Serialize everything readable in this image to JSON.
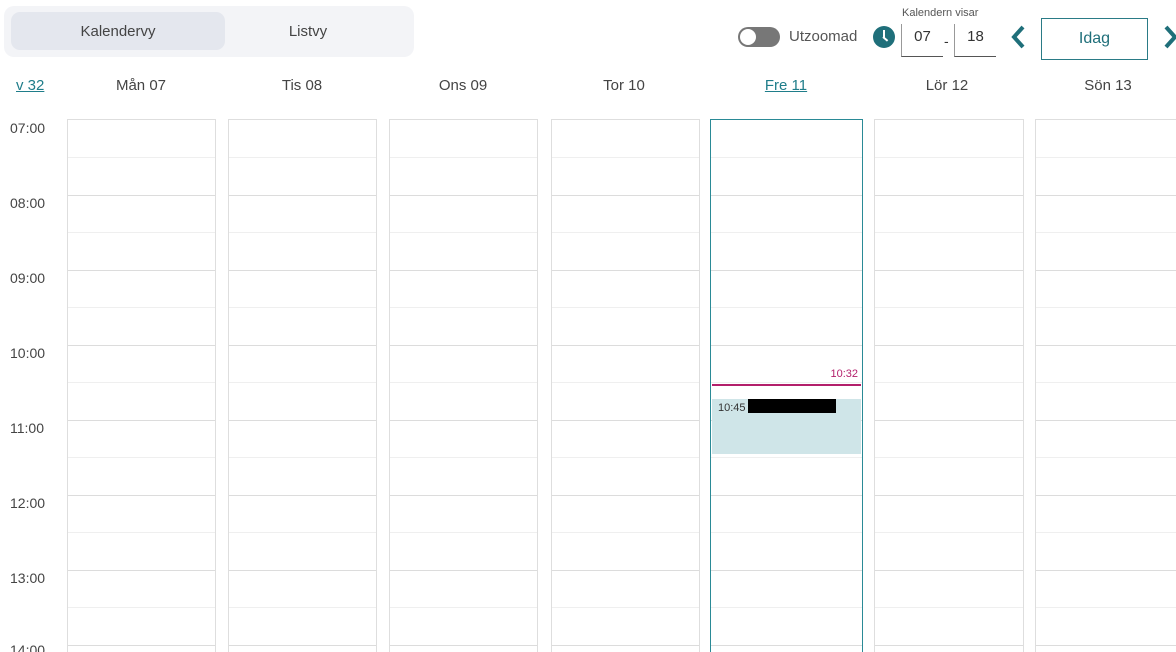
{
  "views": {
    "calendar_label": "Kalendervy",
    "list_label": "Listvy"
  },
  "zoom": {
    "label": "Utzoomad",
    "enabled": false
  },
  "range": {
    "caption": "Kalendern visar",
    "from": "07",
    "separator": "-",
    "to": "18"
  },
  "nav": {
    "today_label": "Idag"
  },
  "week": {
    "label": "v 32"
  },
  "days": [
    {
      "label": "Mån 07",
      "today": false
    },
    {
      "label": "Tis 08",
      "today": false
    },
    {
      "label": "Ons 09",
      "today": false
    },
    {
      "label": "Tor 10",
      "today": false
    },
    {
      "label": "Fre 11",
      "today": true
    },
    {
      "label": "Lör 12",
      "today": false
    },
    {
      "label": "Sön 13",
      "today": false
    }
  ],
  "times": [
    "07:00",
    "08:00",
    "09:00",
    "10:00",
    "11:00",
    "12:00",
    "13:00",
    "14:00"
  ],
  "current_time": "10:32",
  "event": {
    "time": "10:45"
  },
  "colors": {
    "accent": "#1f7d8a",
    "now": "#b31f6b",
    "event_bg": "#cfe5e8"
  }
}
